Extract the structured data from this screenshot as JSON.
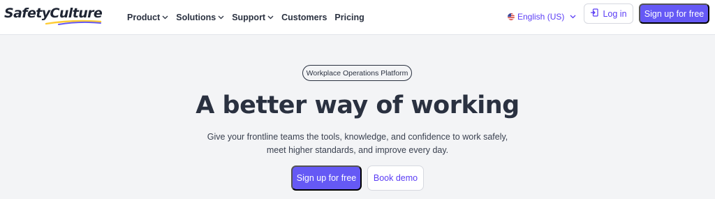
{
  "header": {
    "logo_text": "SafetyCulture",
    "nav": [
      {
        "label": "Product",
        "has_dropdown": true
      },
      {
        "label": "Solutions",
        "has_dropdown": true
      },
      {
        "label": "Support",
        "has_dropdown": true
      },
      {
        "label": "Customers",
        "has_dropdown": false
      },
      {
        "label": "Pricing",
        "has_dropdown": false
      }
    ],
    "language": {
      "label": "English (US)",
      "flag_icon": "us-flag-icon"
    },
    "login_label": "Log in",
    "signup_label": "Sign up for free"
  },
  "hero": {
    "pill_label": "Workplace Operations Platform",
    "headline": "A better way of working",
    "subtitle_line1": "Give your frontline teams the tools, knowledge, and confidence to work safely,",
    "subtitle_line2": "meet higher standards, and improve every day.",
    "primary_cta": "Sign up for free",
    "secondary_cta": "Book demo"
  },
  "colors": {
    "accent": "#6559f5",
    "link": "#5b3df5",
    "hero_bg": "#f3f4f6",
    "text_dark": "#2a3140"
  }
}
